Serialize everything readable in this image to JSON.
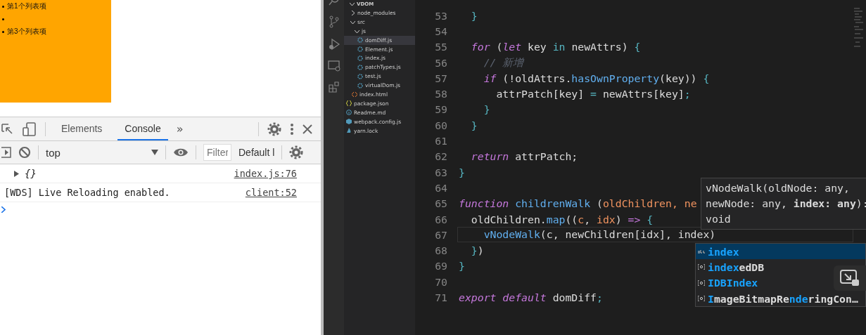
{
  "page": {
    "list_items": [
      {
        "kind": "text",
        "text": "第1个列表项"
      },
      {
        "kind": "empty"
      },
      {
        "kind": "text",
        "text": "第3个列表项"
      }
    ]
  },
  "devtools": {
    "tabs": [
      {
        "label": "Elements",
        "selected": false
      },
      {
        "label": "Console",
        "selected": true
      }
    ],
    "more_tabs": "»",
    "context": "top",
    "filter": {
      "placeholder": "Filter"
    },
    "levels": "Default l",
    "messages": [
      {
        "kind": "object",
        "text": "{}",
        "source": "index.js:76"
      },
      {
        "kind": "log",
        "text": "[WDS] Live Reloading enabled.",
        "source": "client:52"
      }
    ]
  },
  "explorer": {
    "root": "VDOM",
    "items": [
      {
        "name": "node_modules",
        "kind": "folder",
        "expanded": false,
        "selected": false
      },
      {
        "name": "src",
        "kind": "folder",
        "expanded": true,
        "selected": false,
        "children": [
          {
            "name": "js",
            "kind": "folder",
            "expanded": true,
            "selected": false,
            "children": [
              {
                "name": "domDiff.js",
                "kind": "js",
                "selected": true
              },
              {
                "name": "Element.js",
                "kind": "js",
                "selected": false
              },
              {
                "name": "index.js",
                "kind": "js",
                "selected": false
              },
              {
                "name": "patchTypes.js",
                "kind": "js",
                "selected": false
              },
              {
                "name": "test.js",
                "kind": "js",
                "selected": false
              },
              {
                "name": "virtualDom.js",
                "kind": "js",
                "selected": false
              }
            ]
          },
          {
            "name": "index.html",
            "kind": "html",
            "selected": false
          }
        ]
      },
      {
        "name": "package.json",
        "kind": "json",
        "selected": false
      },
      {
        "name": "Readme.md",
        "kind": "md",
        "selected": false
      },
      {
        "name": "webpack.config.js",
        "kind": "webpack",
        "selected": false
      },
      {
        "name": "yarn.lock",
        "kind": "lock",
        "selected": false
      }
    ]
  },
  "editor": {
    "lines": [
      {
        "number": "53",
        "current": false,
        "tokens": [
          {
            "text": "  }",
            "kind": "brace"
          }
        ]
      },
      {
        "number": "54",
        "current": false
      },
      {
        "number": "55",
        "current": false,
        "tokens": [
          {
            "text": "  for",
            "kind": "keyword"
          },
          {
            "text": " (",
            "kind": "plain"
          },
          {
            "text": "let",
            "kind": "keyword"
          },
          {
            "text": " key ",
            "kind": "plain"
          },
          {
            "text": "in",
            "kind": "op"
          },
          {
            "text": " newAttrs) ",
            "kind": "plain"
          },
          {
            "text": "{",
            "kind": "brace"
          }
        ]
      },
      {
        "number": "56",
        "current": false,
        "tokens": [
          {
            "text": "    // 新增",
            "kind": "comment"
          }
        ]
      },
      {
        "number": "57",
        "current": false,
        "tokens": [
          {
            "text": "    if",
            "kind": "keyword"
          },
          {
            "text": " (!oldAttrs.",
            "kind": "plain"
          },
          {
            "text": "hasOwnProperty",
            "kind": "fn"
          },
          {
            "text": "(key)) ",
            "kind": "plain"
          },
          {
            "text": "{",
            "kind": "brace"
          }
        ]
      },
      {
        "number": "58",
        "current": false,
        "tokens": [
          {
            "text": "      attrPatch[key] ",
            "kind": "plain"
          },
          {
            "text": "=",
            "kind": "op"
          },
          {
            "text": " newAttrs[key]",
            "kind": "plain"
          },
          {
            "text": ";",
            "kind": "op"
          }
        ]
      },
      {
        "number": "59",
        "current": false,
        "tokens": [
          {
            "text": "    }",
            "kind": "brace"
          }
        ]
      },
      {
        "number": "60",
        "current": false,
        "tokens": [
          {
            "text": "  }",
            "kind": "brace"
          }
        ]
      },
      {
        "number": "61",
        "current": false
      },
      {
        "number": "62",
        "current": false,
        "tokens": [
          {
            "text": "  return",
            "kind": "keyword"
          },
          {
            "text": " attrPatch;",
            "kind": "plain"
          }
        ]
      },
      {
        "number": "63",
        "current": false,
        "tokens": [
          {
            "text": "}",
            "kind": "brace"
          }
        ]
      },
      {
        "number": "64",
        "current": false
      },
      {
        "number": "65",
        "current": false,
        "tokens": [
          {
            "text": "function",
            "kind": "keyword"
          },
          {
            "text": " childrenWalk",
            "kind": "fn"
          },
          {
            "text": " (",
            "kind": "plain"
          },
          {
            "text": "oldChildren, ne",
            "kind": "param"
          }
        ]
      },
      {
        "number": "66",
        "current": false,
        "tokens": [
          {
            "text": "  oldChildren.",
            "kind": "plain"
          },
          {
            "text": "map",
            "kind": "fn"
          },
          {
            "text": "((",
            "kind": "plain"
          },
          {
            "text": "c",
            "kind": "param"
          },
          {
            "text": ", ",
            "kind": "plain"
          },
          {
            "text": "idx",
            "kind": "param"
          },
          {
            "text": ") ",
            "kind": "plain"
          },
          {
            "text": "=>",
            "kind": "keyword"
          },
          {
            "text": " {",
            "kind": "brace"
          }
        ]
      },
      {
        "number": "67",
        "current": true,
        "tokens": [
          {
            "text": "    vNodeWalk",
            "kind": "fn"
          },
          {
            "text": "(c, newChildren[idx], index)",
            "kind": "plain"
          }
        ]
      },
      {
        "number": "68",
        "current": false,
        "tokens": [
          {
            "text": "  }",
            "kind": "brace"
          },
          {
            "text": ")",
            "kind": "plain"
          }
        ]
      },
      {
        "number": "69",
        "current": false,
        "tokens": [
          {
            "text": "}",
            "kind": "brace"
          }
        ]
      },
      {
        "number": "70",
        "current": false
      },
      {
        "number": "71",
        "current": false,
        "tokens": [
          {
            "text": "export default",
            "kind": "keyword"
          },
          {
            "text": " domDiff",
            "kind": "plain"
          },
          {
            "text": ";",
            "kind": "op"
          }
        ]
      }
    ],
    "hover": {
      "signature": "vNodeWalk(oldNode: any, newNode: any, **index: any**): void"
    },
    "suggestions": [
      {
        "kind": "text",
        "selected": true,
        "parts": [
          {
            "text": "index",
            "match": true
          }
        ]
      },
      {
        "kind": "variable",
        "selected": false,
        "parts": [
          {
            "text": "index",
            "match": true
          },
          {
            "text": "edDB",
            "match": false
          }
        ]
      },
      {
        "kind": "variable",
        "selected": false,
        "parts": [
          {
            "text": "IDBIndex",
            "match": true
          }
        ]
      },
      {
        "kind": "variable",
        "selected": false,
        "parts": [
          {
            "text": "I",
            "match": true
          },
          {
            "text": "mageBitmapRe",
            "match": false
          },
          {
            "text": "nde",
            "match": true
          },
          {
            "text": "ringCon…",
            "match": false
          }
        ]
      }
    ]
  }
}
